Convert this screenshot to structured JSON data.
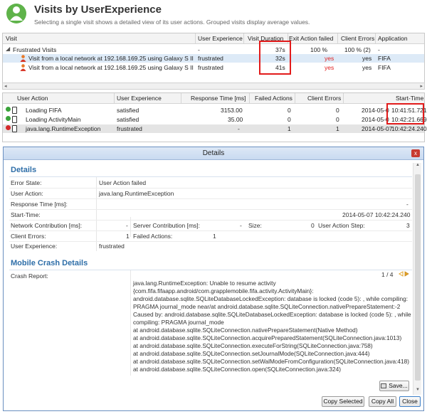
{
  "header": {
    "title": "Visits by UserExperience",
    "subtitle": "Selecting a single visit shows a detailed view of its user actions. Grouped visits display average values."
  },
  "visit_table": {
    "columns": [
      "Visit",
      "User Experience",
      "Visit Duration",
      "Exit Action failed",
      "Client Errors",
      "Application"
    ],
    "group": {
      "label": "Frustrated Visits",
      "user_experience": "-",
      "duration": "37s",
      "exit_action_failed": "100 %",
      "client_errors": "100 % (2)",
      "application": "-"
    },
    "rows": [
      {
        "visit": "Visit from a local network at 192.168.169.25 using Galaxy S II",
        "user_experience": "frustrated",
        "duration": "32s",
        "exit_action_failed": "yes",
        "client_errors": "yes",
        "application": "FIFA"
      },
      {
        "visit": "Visit from a local network at 192.168.169.25 using Galaxy S II",
        "user_experience": "frustrated",
        "duration": "41s",
        "exit_action_failed": "yes",
        "client_errors": "yes",
        "application": "FIFA"
      }
    ],
    "scroll_left": "◂",
    "scroll_right": "▸"
  },
  "action_table": {
    "columns": [
      "User Action",
      "User Experience",
      "Response Time [ms]",
      "Failed Actions",
      "Client Errors",
      "Start-Time"
    ],
    "rows": [
      {
        "action": "Loading FIFA",
        "user_experience": "satisfied",
        "response_time": "3153.00",
        "failed_actions": "0",
        "client_errors": "0",
        "start_date": "2014-05-0",
        "start_time": "10:41:51.721",
        "status_color": "#3aa33a"
      },
      {
        "action": "Loading ActivityMain",
        "user_experience": "satisfied",
        "response_time": "35.00",
        "failed_actions": "0",
        "client_errors": "0",
        "start_date": "2014-05-0",
        "start_time": "10:42:21.669",
        "status_color": "#3aa33a"
      },
      {
        "action": "java.lang.RuntimeException",
        "user_experience": "frustrated",
        "response_time": "-",
        "failed_actions": "1",
        "client_errors": "1",
        "start_date": "2014-05-07",
        "start_time": "10:42:24.240",
        "status_color": "#d42a2a"
      }
    ]
  },
  "dialog": {
    "title": "Details",
    "close_label": "x",
    "details_heading": "Details",
    "fields": {
      "error_state_label": "Error State:",
      "error_state_value": "User Action failed",
      "user_action_label": "User Action:",
      "user_action_value": "java.lang.RuntimeException",
      "response_time_label": "Response Time [ms]:",
      "response_time_value": "-",
      "start_time_label": "Start-Time:",
      "start_time_value": "2014-05-07 10:42:24.240",
      "network_contribution_label": "Network Contribution [ms]:",
      "network_contribution_value": "-",
      "server_contribution_label": "Server Contribution [ms]:",
      "server_contribution_value": "-",
      "size_label": "Size:",
      "size_value": "0",
      "user_action_step_label": "User Action Step:",
      "user_action_step_value": "3",
      "client_errors_label": "Client Errors:",
      "client_errors_value": "1",
      "failed_actions_label": "Failed Actions:",
      "failed_actions_value": "1",
      "user_experience_label": "User Experience:",
      "user_experience_value": "frustrated"
    },
    "crash_heading": "Mobile Crash Details",
    "crash_report_label": "Crash Report:",
    "crash_pager": "1 / 4",
    "crash_lines": [
      "java.lang.RuntimeException: Unable to resume activity",
      "{com.fifa.fifaapp.android/com.grapplemobile.fifa.activity.ActivityMain}:",
      "android.database.sqlite.SQLiteDatabaseLockedException: database is locked (code 5): , while compiling:",
      "PRAGMA journal_mode near/at android.database.sqlite.SQLiteConnection.nativePrepareStatement:-2",
      "Caused by: android.database.sqlite.SQLiteDatabaseLockedException: database is locked (code 5): , while",
      "compiling: PRAGMA journal_mode",
      "  at android.database.sqlite.SQLiteConnection.nativePrepareStatement(Native Method)",
      "  at android.database.sqlite.SQLiteConnection.acquirePreparedStatement(SQLiteConnection.java:1013)",
      "  at android.database.sqlite.SQLiteConnection.executeForString(SQLiteConnection.java:758)",
      "  at android.database.sqlite.SQLiteConnection.setJournalMode(SQLiteConnection.java:444)",
      "  at android.database.sqlite.SQLiteConnection.setWalModeFromConfiguration(SQLiteConnection.java:418)",
      "  at android.database.sqlite.SQLiteConnection.open(SQLiteConnection.java:324)"
    ],
    "buttons": {
      "save": "Save...",
      "copy_selected": "Copy Selected",
      "copy_all": "Copy All",
      "close": "Close"
    }
  },
  "colors": {
    "accent": "#2e6ea8",
    "highlight": "#e21b1b",
    "error_text": "#e02020"
  }
}
